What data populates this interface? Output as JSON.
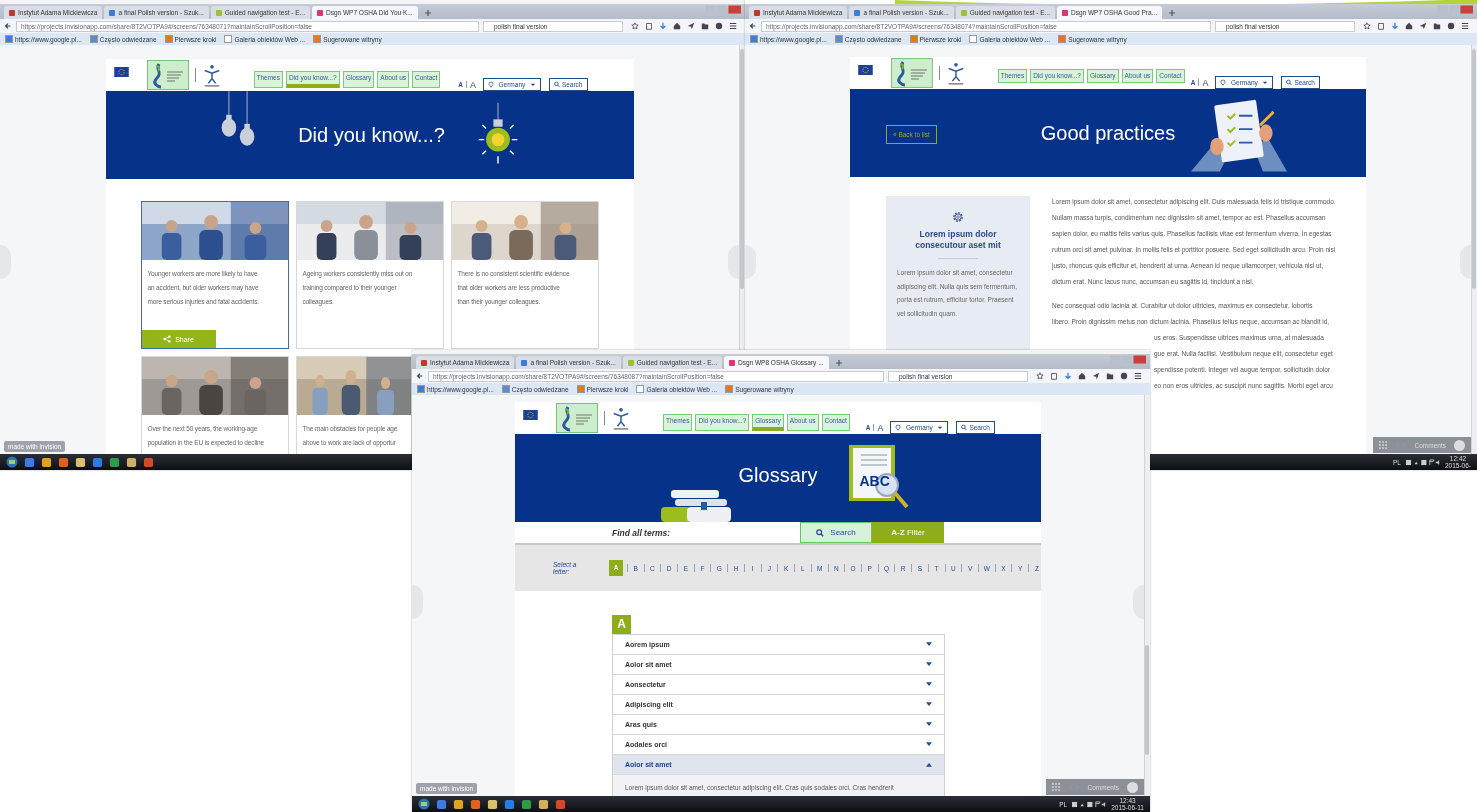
{
  "windows": [
    {
      "kind": "did_you_know",
      "tabs": [
        {
          "label": "Instytut Adama Mickiewicza",
          "selected": false,
          "color": "#c0392b"
        },
        {
          "label": "a final Polish version - Szuk...",
          "selected": false,
          "color": "#3b7ddd"
        },
        {
          "label": "Guided navigation test - E...",
          "selected": false,
          "color": "#9bbf3a"
        },
        {
          "label": "Dsgn WP7 OSHA Did You K...",
          "selected": true,
          "color": "#e0336f"
        }
      ],
      "address": "https://projects.invisionapp.com/share/8T2VOTPA9#/screens/76348071?maintainScrollPosition=false",
      "search": "polish final version",
      "bookmarks": [
        {
          "label": "https://www.google.pl...",
          "color": "#3b7ddd"
        },
        {
          "label": "Często odwiedzane",
          "color": "#5b8bd0"
        },
        {
          "label": "Pierwsze kroki",
          "color": "#e07b1a"
        },
        {
          "label": "Galeria obiektów Web ...",
          "color": "#ffffff"
        },
        {
          "label": "Sugerowane witryny",
          "color": "#e8761e"
        }
      ],
      "nav": [
        {
          "label": "Themes",
          "selected": false
        },
        {
          "label": "Did you know...?",
          "selected": true
        },
        {
          "label": "Glossary",
          "selected": false
        },
        {
          "label": "About us",
          "selected": false
        },
        {
          "label": "Contact",
          "selected": false
        }
      ],
      "font_sizes": [
        "A",
        "A"
      ],
      "country": "Germany",
      "search_label": "Search",
      "hero_title": "Did you know...?",
      "cards": [
        {
          "lines": [
            "Younger workers are more likely to have",
            "an accident, but older workers may have",
            "more serious injuries and fatal accidents."
          ],
          "highlighted": true,
          "share": "Share"
        },
        {
          "lines": [
            "Ageing workers consistently miss out on",
            "training compared to their younger",
            "colleagues."
          ],
          "highlighted": false
        },
        {
          "lines": [
            "There is no consistent scientific evidence",
            "that older workers are less productive",
            "than their younger colleagues."
          ],
          "highlighted": false
        },
        {
          "lines": [
            "Over the next 50 years, the working-age",
            "population in the EU is expected to decline"
          ],
          "highlighted": false
        },
        {
          "lines": [
            "The main obstacles for people age",
            "above to work are lack of opportur"
          ],
          "highlighted": false
        }
      ],
      "invision_badge": "made with invision"
    },
    {
      "kind": "good_practices",
      "tabs": [
        {
          "label": "Instytut Adama Mickiewicza",
          "selected": false,
          "color": "#c0392b"
        },
        {
          "label": "a final Polish version - Szuk...",
          "selected": false,
          "color": "#3b7ddd"
        },
        {
          "label": "Guided navigation test - E...",
          "selected": false,
          "color": "#9bbf3a"
        },
        {
          "label": "Dsgn WP7 OSHA Good Pra...",
          "selected": true,
          "color": "#e0336f"
        }
      ],
      "address": "https://projects.invisionapp.com/share/8T2VOTPA9#/screens/76348074?maintainScrollPosition=false",
      "search": "polish final version",
      "bookmarks": [
        {
          "label": "https://www.google.pl...",
          "color": "#3b7ddd"
        },
        {
          "label": "Często odwiedzane",
          "color": "#5b8bd0"
        },
        {
          "label": "Pierwsze kroki",
          "color": "#e07b1a"
        },
        {
          "label": "Galeria obiektów Web ...",
          "color": "#ffffff"
        },
        {
          "label": "Sugerowane witryny",
          "color": "#e8761e"
        }
      ],
      "nav": [
        {
          "label": "Themes",
          "selected": false
        },
        {
          "label": "Did you know...?",
          "selected": false
        },
        {
          "label": "Glossary",
          "selected": false
        },
        {
          "label": "About us",
          "selected": false
        },
        {
          "label": "Contact",
          "selected": false
        }
      ],
      "font_sizes": [
        "A",
        "A"
      ],
      "country": "Germany",
      "search_label": "Search",
      "back": "« Back to list",
      "hero_title": "Good practices",
      "aside": {
        "title": "Lorem ipsum dolor consecutour aset mit",
        "text": "Lorem ipsum dolor sit amet, consectetur adipiscing elit. Nulla quis sem fermentum, porta est rutrum, efficitur tortor. Praesent vel sollicitudin quam."
      },
      "paragraph": "Lorem ipsum dolor sit amet, consectetur adipiscing elit. Duis malesuada felis id tristique commodo. Nullam massa turpis, condimentum nec dignissim sit amet, tempor ac est. Phasellus accumsan sapien dolor, eu mattis felis varius quis. Phasellus facilisis vitae est fermentum viverra. In egestas rutrum orci sit amet pulvinar. In mollis felis et porttitor posuere. Sed eget sollicitudin arcu. Proin nisi justo, rhoncus quis efficitur et, hendrerit at urna. Aenean id neque ullamcorper, vehicula nisl ut, dictum erat. Nunc lacus nunc, accumsan eu sagittis id, tincidunt a nisl.",
      "paragraph_2_lines": [
        "Nec consequat odio lacinia at. Curabitur ut dolor ultricies, maximus ex consectetur, lobortis",
        "libero. Proin dignissim metus non dictum lacinia. Phasellus tellus neque, accumsan ac blandit id,"
      ],
      "paragraph_2_fragments": [
        "us eros. Suspendisse ultrices maximus urna, at malesuada",
        "gue erat. Nulla facilisi. Vestibulum neque elit, consectetur eget",
        "spendisse potenti. Integer vel augue tempor, sollicitudin dolor",
        "eo non eros ultricies, ac suscipit nunc sagittis. Morbi eget arcu"
      ],
      "comments": "Comments",
      "tray": {
        "lang": "PL",
        "time": "12:42",
        "date": "2015-06-"
      }
    },
    {
      "kind": "glossary",
      "tabs": [
        {
          "label": "Instytut Adama Mickiewicza",
          "selected": false,
          "color": "#c0392b"
        },
        {
          "label": "a final Polish version - Szuk...",
          "selected": false,
          "color": "#3b7ddd"
        },
        {
          "label": "Guided navigation test - E...",
          "selected": false,
          "color": "#9bbf3a"
        },
        {
          "label": "Dsgn WP8 OSHA Glossary ...",
          "selected": true,
          "color": "#e0336f"
        }
      ],
      "address": "https://projects.invisionapp.com/share/8T2VOTPA9#/screens/76348087?maintainScrollPosition=false",
      "search": "polish final version",
      "bookmarks": [
        {
          "label": "https://www.google.pl...",
          "color": "#3b7ddd"
        },
        {
          "label": "Często odwiedzane",
          "color": "#5b8bd0"
        },
        {
          "label": "Pierwsze kroki",
          "color": "#e07b1a"
        },
        {
          "label": "Galeria obiektów Web ...",
          "color": "#ffffff"
        },
        {
          "label": "Sugerowane witryny",
          "color": "#e8761e"
        }
      ],
      "nav": [
        {
          "label": "Themes",
          "selected": false
        },
        {
          "label": "Did you know...?",
          "selected": false
        },
        {
          "label": "Glossary",
          "selected": true
        },
        {
          "label": "About us",
          "selected": false
        },
        {
          "label": "Contact",
          "selected": false
        }
      ],
      "font_sizes": [
        "A",
        "A"
      ],
      "country": "Germany",
      "search_label": "Search",
      "hero_title": "Glossary",
      "hero_badge": "ABC",
      "find_label": "Find all terms:",
      "find_tabs": [
        {
          "label": "Search",
          "selected": false
        },
        {
          "label": "**A-Z** Filter",
          "selected": true
        }
      ],
      "letters_label": "Select a letter:",
      "letters": [
        {
          "label": "A",
          "selected": true
        },
        {
          "label": "B",
          "selected": false
        },
        {
          "label": "C",
          "selected": false
        },
        {
          "label": "D",
          "selected": false
        },
        {
          "label": "E",
          "selected": false
        },
        {
          "label": "F",
          "selected": false
        },
        {
          "label": "G",
          "selected": false
        },
        {
          "label": "H",
          "selected": false
        },
        {
          "label": "I",
          "selected": false
        },
        {
          "label": "J",
          "selected": false
        },
        {
          "label": "K",
          "selected": false
        },
        {
          "label": "L",
          "selected": false
        },
        {
          "label": "M",
          "selected": false
        },
        {
          "label": "N",
          "selected": false
        },
        {
          "label": "O",
          "selected": false
        },
        {
          "label": "P",
          "selected": false
        },
        {
          "label": "Q",
          "selected": false
        },
        {
          "label": "R",
          "selected": false
        },
        {
          "label": "S",
          "selected": false
        },
        {
          "label": "T",
          "selected": false
        },
        {
          "label": "U",
          "selected": false
        },
        {
          "label": "V",
          "selected": false
        },
        {
          "label": "W",
          "selected": false
        },
        {
          "label": "X",
          "selected": false
        },
        {
          "label": "Y",
          "selected": false
        },
        {
          "label": "Z",
          "selected": false
        }
      ],
      "group": "A",
      "terms": [
        {
          "label": "Aorem ipsum",
          "expanded": false
        },
        {
          "label": "Aolor sit amet",
          "expanded": false
        },
        {
          "label": "Aonsectetur",
          "expanded": false
        },
        {
          "label": "Adipiscing elit",
          "expanded": false
        },
        {
          "label": "Aras quis",
          "expanded": false
        },
        {
          "label": "Aodales orci",
          "expanded": false
        },
        {
          "label": "Aolor sit amet",
          "expanded": true,
          "text": "Lorem ipsum dolor sit amet, consectetur adipiscing elit. Cras quis sodales orci. Cras hendrerit"
        }
      ],
      "invision_badge": "made with invision",
      "comments": "Comments",
      "tray": {
        "lang": "PL",
        "time": "12:43",
        "date": "2015-06-11"
      }
    }
  ]
}
